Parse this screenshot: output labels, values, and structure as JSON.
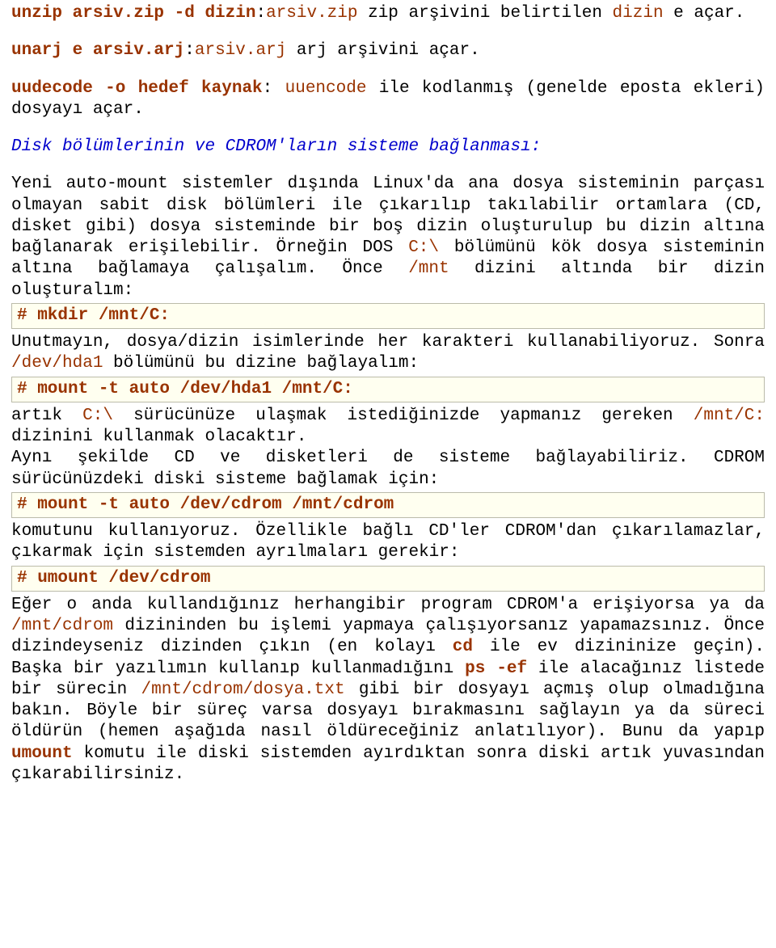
{
  "p1": {
    "cmd": "unzip arsiv.zip -d dizin",
    "sep": ":",
    "arg": "arsiv.zip",
    "tail": " zip arşivini belirtilen ",
    "brown2": "dizin",
    "tail2": " e açar."
  },
  "p2": {
    "cmd": "unarj e arsiv.arj",
    "sep": ":",
    "arg": "arsiv.arj",
    "tail": " arj arşivini açar."
  },
  "p3": {
    "cmd": "uudecode -o hedef kaynak",
    "sep": ": ",
    "arg": "uuencode",
    "tail": " ile kodlanmış (genelde eposta ekleri) dosyayı açar."
  },
  "hd": "Disk bölümlerinin ve CDROM'ların sisteme bağlanması:",
  "p4a": "Yeni auto-mount sistemler dışında Linux'da ana dosya sisteminin parçası olmayan sabit disk bölümleri ile çıkarılıp takılabilir ortamlara (CD, disket gibi) dosya sisteminde bir boş dizin oluşturulup bu dizin altına bağlanarak erişilebilir. Örneğin DOS ",
  "p4b": "C:\\",
  "p4c": " bölümünü kök dosya sisteminin altına bağlamaya çalışalım. Önce ",
  "p4d": "/mnt",
  "p4e": " dizini altında bir dizin oluşturalım:",
  "box1": "# mkdir /mnt/C:",
  "p5a": "Unutmayın, dosya/dizin isimlerinde her karakteri kullanabiliyoruz. Sonra ",
  "p5b": "/dev/hda1",
  "p5c": " bölümünü bu dizine bağlayalım:",
  "box2": "# mount -t auto /dev/hda1 /mnt/C:",
  "p6a": "artık ",
  "p6b": "C:\\",
  "p6c": " sürücünüze ulaşmak istediğinizde yapmanız gereken ",
  "p6d": "/mnt/C:",
  "p6e": " dizinini kullanmak olacaktır.",
  "p6f": "Aynı şekilde CD ve disketleri de sisteme bağlayabiliriz. CDROM sürücünüzdeki diski sisteme bağlamak için:",
  "box3": "# mount -t auto /dev/cdrom /mnt/cdrom",
  "p7": "komutunu kullanıyoruz. Özellikle bağlı CD'ler CDROM'dan çıkarılamazlar, çıkarmak için sistemden ayrılmaları gerekir:",
  "box4": "# umount /dev/cdrom",
  "p8a": "Eğer o anda kullandığınız herhangibir program CDROM'a erişiyorsa ya da ",
  "p8b": "/mnt/cdrom",
  "p8c": " dizininden bu işlemi yapmaya çalışıyorsanız yapamazsınız. Önce dizindeyseniz dizinden çıkın (en kolayı ",
  "p8d": "cd",
  "p8e": " ile ev dizininize geçin). Başka bir yazılımın kullanıp kullanmadığını ",
  "p8f": "ps -ef",
  "p8g": " ile alacağınız listede bir sürecin ",
  "p8h": "/mnt/cdrom/dosya.txt",
  "p8i": " gibi bir dosyayı açmış olup olmadığına bakın. Böyle bir süreç varsa dosyayı bırakmasını sağlayın ya da süreci öldürün (hemen aşağıda nasıl öldüreceğiniz anlatılıyor). Bunu da yapıp ",
  "p8j": "umount",
  "p8k": " komutu ile diski sistemden ayırdıktan sonra diski artık yuvasından çıkarabilirsiniz."
}
